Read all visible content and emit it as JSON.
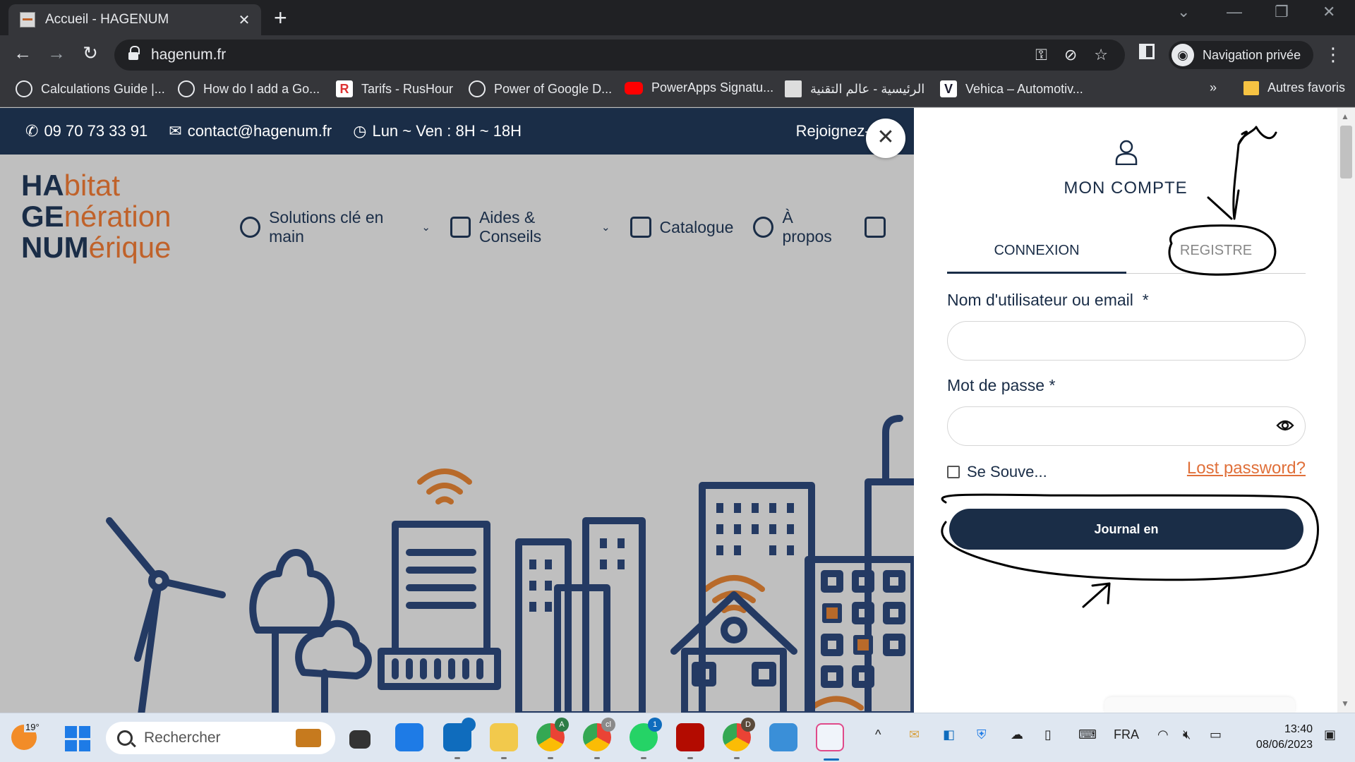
{
  "browser": {
    "tab_title": "Accueil - HAGENUM",
    "url": "hagenum.fr",
    "profile_label": "Navigation privée",
    "bookmarks": [
      {
        "label": "Calculations Guide |..."
      },
      {
        "label": "How do I add a Go..."
      },
      {
        "label": "Tarifs - RusHour"
      },
      {
        "label": "Power of Google D..."
      },
      {
        "label": "PowerApps Signatu..."
      },
      {
        "label": "الرئيسية - عالم التقنية"
      },
      {
        "label": "Vehica – Automotiv..."
      }
    ],
    "more_bookmarks": "»",
    "other_favorites": "Autres favoris"
  },
  "site": {
    "phone": "09 70 73 33 91",
    "email": "contact@hagenum.fr",
    "hours": "Lun ~ Ven : 8H ~ 18H",
    "join": "Rejoignez-n",
    "logo": {
      "l1b": "HA",
      "l1o": "bitat",
      "l2b": "GE",
      "l2o": "nération",
      "l3b": "NUM",
      "l3o": "érique"
    },
    "nav": [
      {
        "label": "Solutions clé en main",
        "caret": true
      },
      {
        "label": "Aides & Conseils",
        "caret": true
      },
      {
        "label": "Catalogue",
        "caret": false
      },
      {
        "label": "À propos",
        "caret": false
      }
    ],
    "colors": {
      "navy": "#1a2d47",
      "orange": "#c0622a",
      "link": "#e0703a"
    }
  },
  "account": {
    "title": "MON COMPTE",
    "tab_login": "CONNEXION",
    "tab_register": "REGISTRE",
    "username_label": "Nom d'utilisateur ou email",
    "username_required": "*",
    "username_value": "",
    "password_label": "Mot de passe",
    "password_required": "*",
    "password_value": "",
    "remember_label": "Se Souve...",
    "remember_checked": false,
    "lost_password": "Lost password?",
    "login_button": "Journal en"
  },
  "taskbar": {
    "weather_temp": "19°",
    "search_placeholder": "Rechercher",
    "language": "FRA",
    "time": "13:40",
    "date": "08/06/2023",
    "apps": [
      {
        "name": "files-app",
        "color": "#f2c94c"
      },
      {
        "name": "outlook",
        "color": "#0f6cbd",
        "badge": ""
      },
      {
        "name": "chrome-A",
        "badge": "A"
      },
      {
        "name": "chrome-cl",
        "badge": "cl"
      },
      {
        "name": "whatsapp",
        "badge": "1"
      },
      {
        "name": "acrobat"
      },
      {
        "name": "chrome-D",
        "badge": "D"
      },
      {
        "name": "photos"
      },
      {
        "name": "snipping-tool"
      }
    ]
  }
}
